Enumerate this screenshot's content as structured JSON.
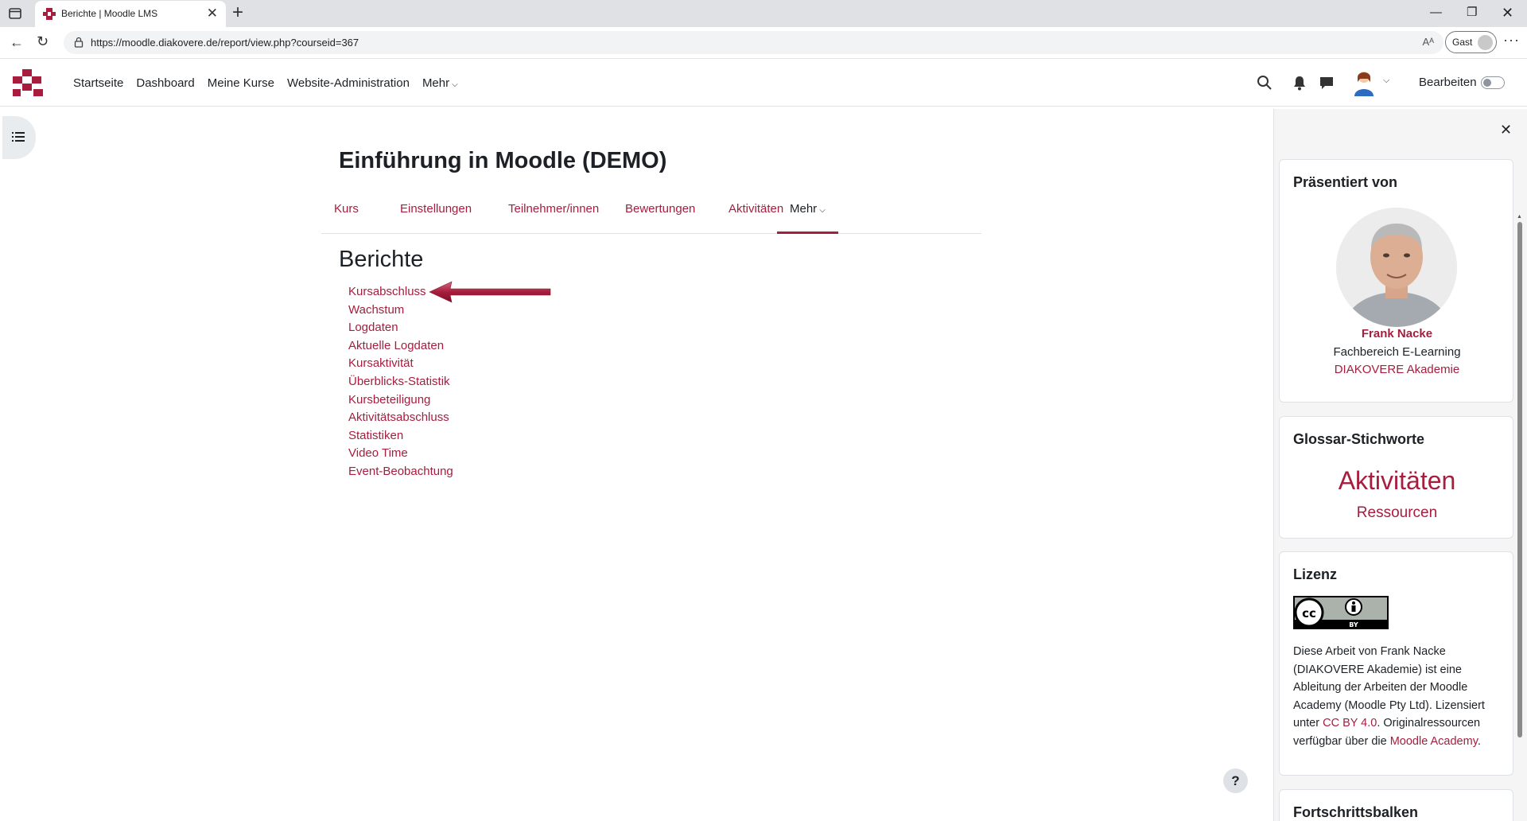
{
  "browser": {
    "tab_title": "Berichte | Moodle LMS",
    "tab_close": "✕",
    "new_tab": "+",
    "url": "https://moodle.diakovere.de/report/view.php?courseid=367",
    "read_aloud": "Aᴬ",
    "profile_label": "Gast",
    "more_menu": "···",
    "win_min": "—",
    "win_max": "❐",
    "win_close": "✕",
    "back": "←",
    "reload": "↻"
  },
  "navbar": {
    "items": [
      {
        "label": "Startseite"
      },
      {
        "label": "Dashboard"
      },
      {
        "label": "Meine Kurse"
      },
      {
        "label": "Website-Administration"
      },
      {
        "label": "Mehr"
      }
    ],
    "edit_label": "Bearbeiten",
    "edit_mode": false
  },
  "course": {
    "title": "Einführung in Moodle (DEMO)",
    "tabs": [
      {
        "label": "Kurs"
      },
      {
        "label": "Einstellungen"
      },
      {
        "label": "Teilnehmer/innen"
      },
      {
        "label": "Bewertungen"
      },
      {
        "label": "Aktivitäten"
      },
      {
        "label": "Mehr",
        "active": true
      }
    ]
  },
  "reports": {
    "heading": "Berichte",
    "links": [
      "Kursabschluss",
      "Wachstum",
      "Logdaten",
      "Aktuelle Logdaten",
      "Kursaktivität",
      "Überblicks-Statistik",
      "Kursbeteiligung",
      "Aktivitätsabschluss",
      "Statistiken",
      "Video Time",
      "Event-Beobachtung"
    ]
  },
  "help": {
    "label": "?"
  },
  "drawer": {
    "close": "✕",
    "presenter": {
      "title": "Präsentiert von",
      "name": "Frank Nacke",
      "department": "Fachbereich E-Learning",
      "organisation": "DIAKOVERE Akademie"
    },
    "glossary": {
      "title": "Glossar-Stichworte",
      "tags": [
        "Aktivitäten",
        "Ressourcen"
      ]
    },
    "license": {
      "title": "Lizenz",
      "badge_text": "BY",
      "text_1": "Diese Arbeit von Frank Nacke (DIAKOVERE Akademie) ist eine Ableitung der Arbeiten der Moodle Academy (Moodle Pty Ltd). Lizensiert unter ",
      "link_1": "CC BY 4.0",
      "text_2": ". Originalressourcen verfügbar über die ",
      "link_2": "Moodle Academy",
      "text_3": "."
    },
    "progress": {
      "title": "Fortschrittsbalken"
    }
  },
  "colors": {
    "brand": "#a71d3e",
    "text": "#1d2125",
    "drawer_bg": "#f5f5f5"
  },
  "icons": [
    "tab-favicon-icon",
    "lock-icon",
    "search-icon",
    "bell-icon",
    "chat-icon",
    "user-avatar-icon",
    "course-index-icon",
    "close-icon",
    "cc-by-license-icon"
  ]
}
